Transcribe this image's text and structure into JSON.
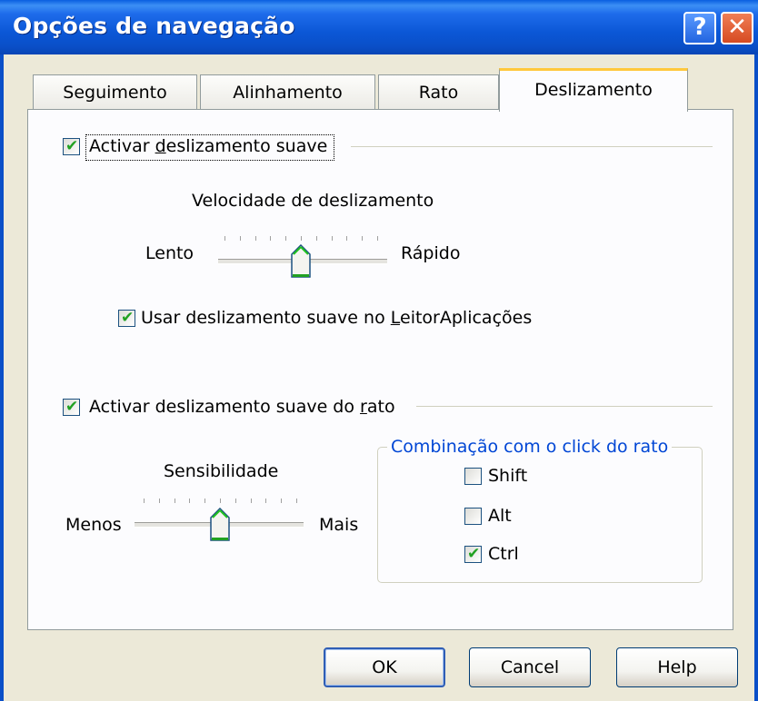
{
  "window": {
    "title": "Opções de navegação",
    "help_button": "?",
    "close_button": "✕"
  },
  "tabs": [
    {
      "label": "Seguimento",
      "active": false
    },
    {
      "label": "Alinhamento",
      "active": false
    },
    {
      "label": "Rato",
      "active": false
    },
    {
      "label": "Deslizamento",
      "active": true
    }
  ],
  "smooth_scroll": {
    "checkbox_label_pre": "Activar ",
    "checkbox_label_ul": "d",
    "checkbox_label_post": "eslizamento suave",
    "checked": true,
    "speed_label": "Velocidade de deslizamento",
    "slow_label": "Lento",
    "fast_label": "Rápido",
    "speed_value_fraction": 0.5,
    "reader_checkbox_pre": "Usar deslizamento suave no ",
    "reader_checkbox_ul": "L",
    "reader_checkbox_post": "eitorAplicações",
    "reader_checked": true
  },
  "mouse_scroll": {
    "checkbox_label_pre": "Activar deslizamento suave do ",
    "checkbox_label_ul": "r",
    "checkbox_label_post": "ato",
    "checked": true,
    "sensitivity_label": "Sensibilidade",
    "less_label": "Menos",
    "more_label": "Mais",
    "sensitivity_value_fraction": 0.5,
    "combo_group_title": "Combinação com o click do rato",
    "combo_options": [
      {
        "label": "Shift",
        "checked": false
      },
      {
        "label": "Alt",
        "checked": false
      },
      {
        "label": "Ctrl",
        "checked": true
      }
    ]
  },
  "buttons": {
    "ok": "OK",
    "cancel": "Cancel",
    "help": "Help"
  },
  "colors": {
    "titlebar": "#0A57D6",
    "tab_highlight": "#FFC83C",
    "check_mark": "#21A121",
    "group_title": "#0046D5",
    "dialog_bg": "#ECE9D8"
  }
}
